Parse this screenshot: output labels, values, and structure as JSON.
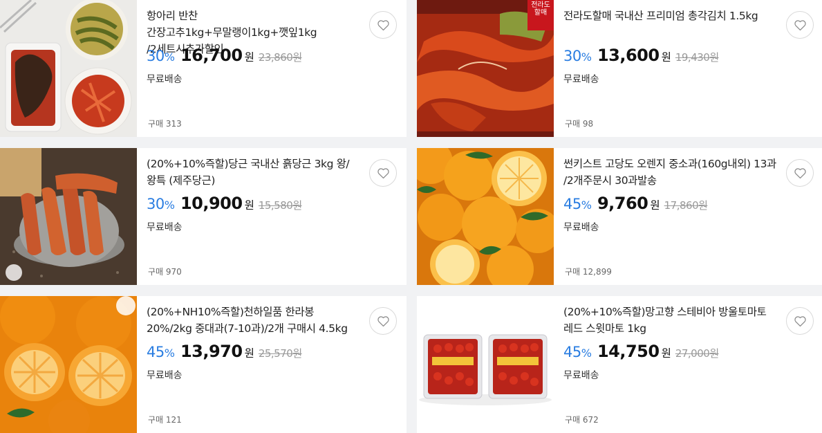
{
  "currency_unit": "원",
  "rate_unit": "%",
  "products": [
    {
      "title": "항아리 반찬 간장고추1kg+무말랭이1kg+깻잎1kg /2세트시추가할인",
      "rate": "30",
      "price": "16,700",
      "original_price": "23,860원",
      "shipping": "무료배송",
      "purchases": "구매 313"
    },
    {
      "title": "전라도할매 국내산 프리미엄 총각김치 1.5kg",
      "rate": "30",
      "price": "13,600",
      "original_price": "19,430원",
      "shipping": "무료배송",
      "purchases": "구매 98",
      "image_label": "전라도할매"
    },
    {
      "title": "(20%+10%즉할)당근 국내산 흙당근 3kg 왕/왕특 (제주당근)",
      "rate": "30",
      "price": "10,900",
      "original_price": "15,580원",
      "shipping": "무료배송",
      "purchases": "구매 970"
    },
    {
      "title": "썬키스트 고당도 오렌지 중소과(160g내외) 13과 /2개주문시 30과발송",
      "rate": "45",
      "price": "9,760",
      "original_price": "17,860원",
      "shipping": "무료배송",
      "purchases": "구매 12,899"
    },
    {
      "title": "(20%+NH10%즉할)천하일품 한라봉 20%/2kg 중대과(7-10과)/2개 구매시 4.5kg",
      "rate": "45",
      "price": "13,970",
      "original_price": "25,570원",
      "shipping": "무료배송",
      "purchases": "구매 121"
    },
    {
      "title": "(20%+10%즉할)망고향 스테비아 방울토마토 레드 스윗마토 1kg",
      "rate": "45",
      "price": "14,750",
      "original_price": "27,000원",
      "shipping": "무료배송",
      "purchases": "구매 672"
    }
  ],
  "icons": {
    "wishlist": "heart-outline-icon"
  },
  "colors": {
    "discount": "#2a7de1",
    "price": "#111111",
    "muted": "#999999",
    "background": "#f1f2f4"
  }
}
